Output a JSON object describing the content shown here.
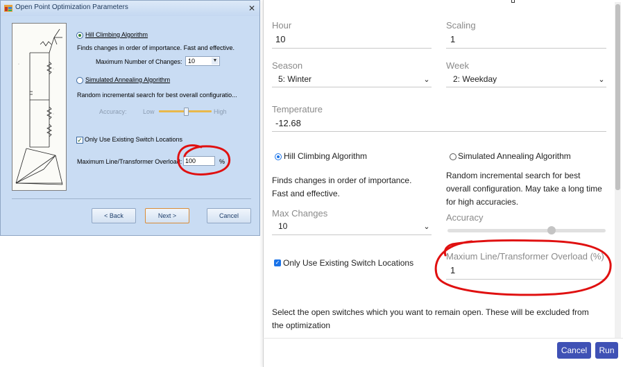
{
  "legacy_dialog": {
    "title": "Open Point Optimization Parameters",
    "hill_climbing_label": "Hill Climbing Algorithm",
    "hill_climbing_desc": "Finds changes in order of importance. Fast and effective.",
    "max_changes_label": "Maximum Number of Changes:",
    "max_changes_value": "10",
    "simulated_annealing_label": "Simulated Annealing Algorithm",
    "simulated_annealing_desc": "Random incremental search for best overall configuratio...",
    "accuracy_label": "Accuracy:",
    "accuracy_low": "Low",
    "accuracy_high": "High",
    "use_existing_label": "Only Use Existing Switch Locations",
    "overload_label": "Maximum Line/Transformer Overload:",
    "overload_value": "100",
    "overload_unit": "%",
    "back_button": "< Back",
    "next_button": "Next >",
    "cancel_button": "Cancel",
    "selected_algorithm": "hill_climbing",
    "use_existing_checked": true
  },
  "web_form": {
    "hour_label": "Hour",
    "hour_value": "10",
    "scaling_label": "Scaling",
    "scaling_value": "1",
    "season_label": "Season",
    "season_value": "5: Winter",
    "week_label": "Week",
    "week_value": "2: Weekday",
    "temperature_label": "Temperature",
    "temperature_value": "-12.68",
    "hill_climbing_label": "Hill Climbing Algorithm",
    "hill_climbing_desc": "Finds changes in order of importance. Fast and effective.",
    "simulated_annealing_label": "Simulated Annealing Algorithm",
    "simulated_annealing_desc": "Random incremental search for best overall configuration. May take a long time for high accuracies.",
    "max_changes_label": "Max Changes",
    "max_changes_value": "10",
    "accuracy_label": "Accuracy",
    "accuracy_level_fraction": 0.66,
    "use_existing_label": "Only Use Existing Switch Locations",
    "overload_label": "Maxium Line/Transformer Overload (%)",
    "overload_value": "1",
    "open_switches_text": "Select the open switches which you want to remain open. These will be excluded from the optimization",
    "cancel_button": "Cancel",
    "run_button": "Run",
    "selected_algorithm": "hill_climbing",
    "use_existing_checked": true
  },
  "colors": {
    "annotation_red": "#e01010",
    "legacy_background": "#c9dcf3",
    "web_primary_button": "#3f51b5",
    "web_radio_accent": "#1a73e8",
    "legacy_slider_track": "#e9b84a"
  },
  "icons": {
    "legacy_app_icon": "app-window-icon",
    "legacy_close": "close-icon",
    "dropdown": "chevron-down-icon",
    "schematic": "circuit-diagram-image"
  }
}
